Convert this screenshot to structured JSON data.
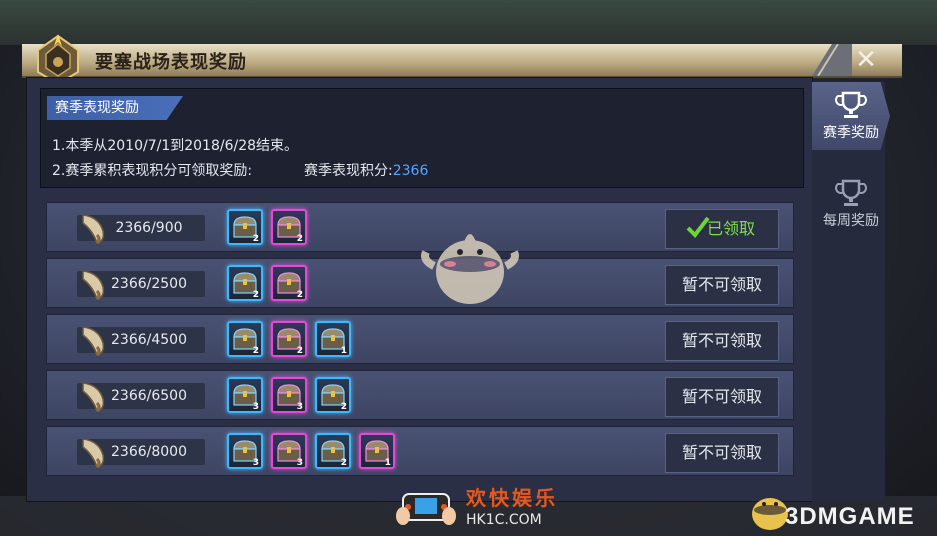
{
  "window": {
    "title": "要塞战场表现奖励",
    "close_glyph": "✕"
  },
  "info": {
    "tab_label": "赛季表现奖励",
    "line1": "1.本季从2010/7/1到2018/6/28结束。",
    "line2": "2.赛季累积表现积分可领取奖励:",
    "score_label": "赛季表现积分:",
    "score_value": "2366"
  },
  "rows": [
    {
      "progress": "2366/900",
      "chests": [
        {
          "color": "blue",
          "count": "2"
        },
        {
          "color": "purple",
          "count": "2"
        }
      ],
      "button": "已领取",
      "claimed": true
    },
    {
      "progress": "2366/2500",
      "chests": [
        {
          "color": "blue",
          "count": "2"
        },
        {
          "color": "purple",
          "count": "2"
        }
      ],
      "button": "暂不可领取",
      "claimed": false
    },
    {
      "progress": "2366/4500",
      "chests": [
        {
          "color": "blue",
          "count": "2"
        },
        {
          "color": "purple",
          "count": "2"
        },
        {
          "color": "blue",
          "count": "1"
        }
      ],
      "button": "暂不可领取",
      "claimed": false
    },
    {
      "progress": "2366/6500",
      "chests": [
        {
          "color": "blue",
          "count": "3"
        },
        {
          "color": "purple",
          "count": "3"
        },
        {
          "color": "blue",
          "count": "2"
        }
      ],
      "button": "暂不可领取",
      "claimed": false
    },
    {
      "progress": "2366/8000",
      "chests": [
        {
          "color": "blue",
          "count": "3"
        },
        {
          "color": "purple",
          "count": "3"
        },
        {
          "color": "blue",
          "count": "2"
        },
        {
          "color": "purple",
          "count": "1"
        }
      ],
      "button": "暂不可领取",
      "claimed": false
    }
  ],
  "side_tabs": [
    {
      "label": "赛季奖励",
      "icon": "trophy-icon",
      "active": true
    },
    {
      "label": "每周奖励",
      "icon": "trophy-icon",
      "active": false
    }
  ],
  "watermark": {
    "site_name": "欢快娱乐",
    "site_url": "HK1C.COM",
    "brand": "3DMGAME"
  },
  "colors": {
    "chest_blue": "#3cb8ff",
    "chest_purple": "#e24ad6",
    "claimed_green": "#7ddf4f",
    "score_blue": "#55a7ff"
  }
}
